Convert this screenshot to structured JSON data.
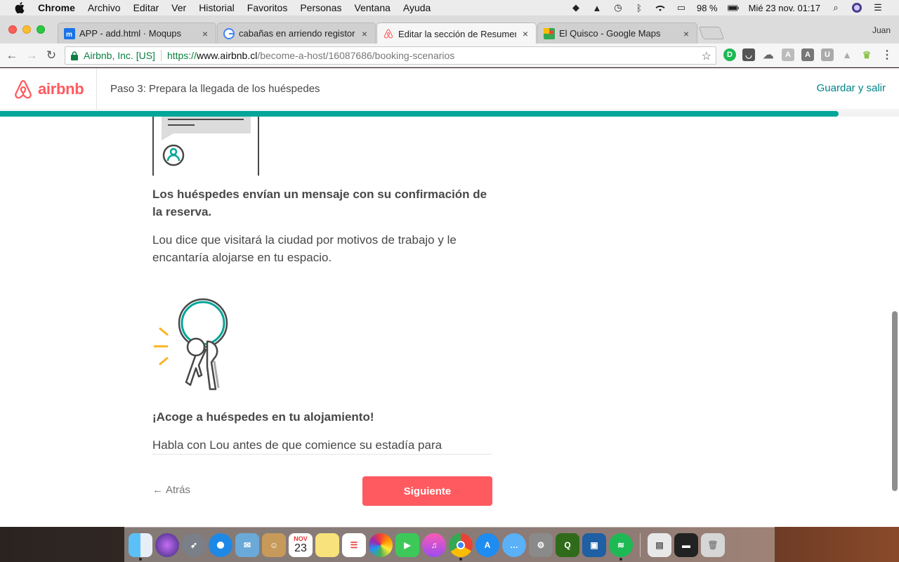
{
  "menubar": {
    "app": "Chrome",
    "items": [
      "Archivo",
      "Editar",
      "Ver",
      "Historial",
      "Favoritos",
      "Personas",
      "Ventana",
      "Ayuda"
    ],
    "battery": "98 %",
    "datetime": "Mié 23 nov.  01:17"
  },
  "browser": {
    "tabs": [
      {
        "label": "APP - add.html · Moqups",
        "icon": "moqups-icon",
        "close": "×"
      },
      {
        "label": "cabañas en arriendo registor - ",
        "icon": "google-icon",
        "close": "×"
      },
      {
        "label": "Editar la sección de Resumen d",
        "icon": "airbnb-icon",
        "close": "×"
      },
      {
        "label": "El Quisco - Google Maps",
        "icon": "maps-icon",
        "close": "×"
      }
    ],
    "profile": "Juan",
    "cert_owner": "Airbnb, Inc. [US]",
    "url_scheme": "https://",
    "url_host": "www.airbnb.cl",
    "url_path": "/become-a-host/16087686/booking-scenarios"
  },
  "header": {
    "brand": "airbnb",
    "step_title": "Paso 3: Prepara la llegada de los huéspedes",
    "save_exit": "Guardar y salir",
    "progress": 0.933
  },
  "content": {
    "section1_title": "Los huéspedes envían un mensaje con su confirmación de la reserva.",
    "section1_body": "Lou dice que visitará la ciudad por motivos de trabajo y le encantaría alojarse en tu espacio.",
    "section2_title": "¡Acoge a huéspedes en tu alojamiento!",
    "section2_body": "Habla con Lou antes de que comience su estadía para"
  },
  "footer": {
    "back": "Atrás",
    "next": "Siguiente"
  },
  "colors": {
    "brand": "#ff5a5f",
    "teal": "#00a699",
    "link": "#008489"
  },
  "dock": [
    "finder-icon",
    "siri-icon",
    "launchpad-icon",
    "safari-icon",
    "mail-icon",
    "contacts-icon",
    "calendar-icon",
    "notes-icon",
    "reminders-icon",
    "photos-icon",
    "facetime-icon",
    "itunes-icon",
    "chrome-icon",
    "appstore-icon",
    "messages-icon",
    "system-preferences-icon",
    "qgis-icon",
    "sourcetree-icon",
    "spotify-icon",
    "downloads-icon",
    "terminal-icon",
    "trash-icon"
  ],
  "calendar_day": "23",
  "calendar_month": "NOV"
}
